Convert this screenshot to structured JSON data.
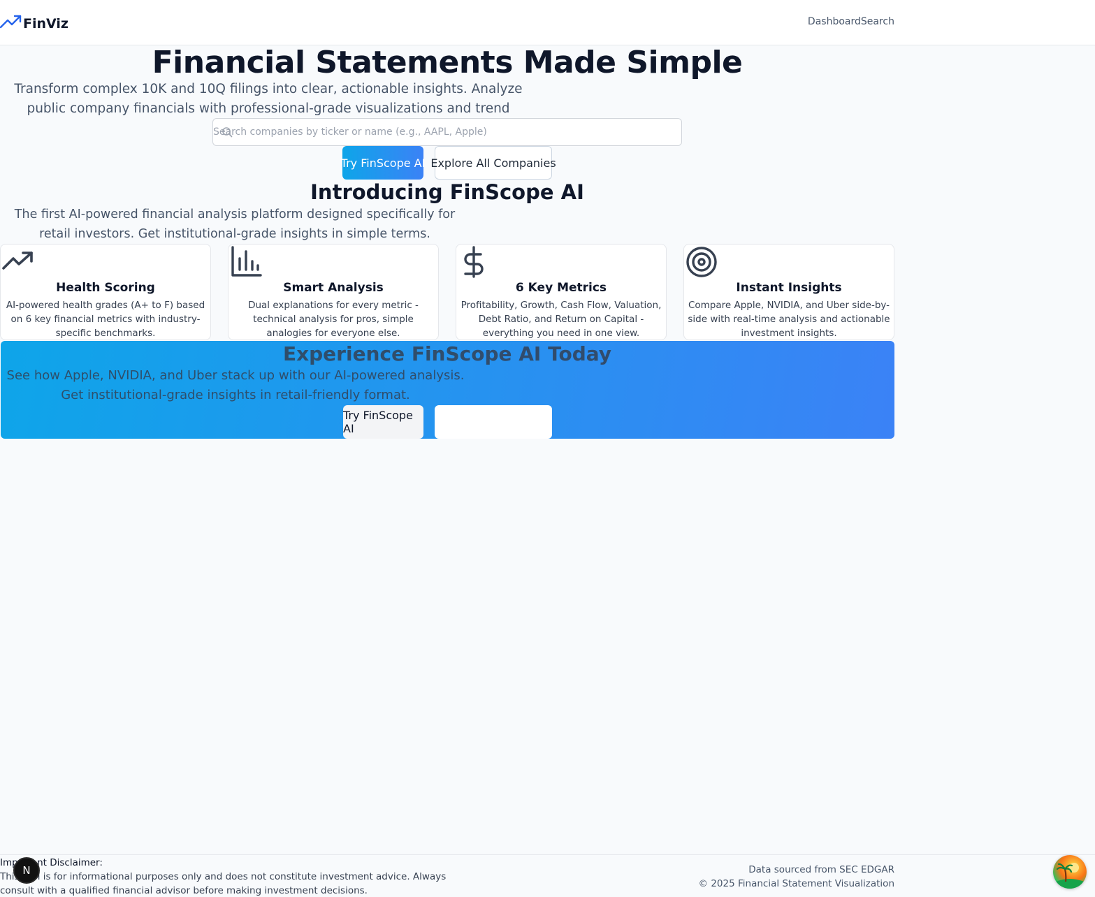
{
  "header": {
    "brand": "FinViz",
    "nav": [
      "Dashboard",
      "Search"
    ]
  },
  "hero": {
    "title": "Financial Statements Made Simple",
    "subtitle": "Transform complex 10K and 10Q filings into clear, actionable insights. Analyze public company financials with professional-grade visualizations and trend analysis.",
    "search_placeholder": "Search companies by ticker or name (e.g., AAPL, Apple)",
    "search_value": "",
    "primary_button": "Try FinScope AI",
    "secondary_button": "Explore All Companies"
  },
  "intro": {
    "title": "Introducing FinScope AI",
    "subtitle": "The first AI-powered financial analysis platform designed specifically for retail investors. Get institutional-grade insights in simple terms."
  },
  "features": [
    {
      "icon": "trending-up-icon",
      "title": "Health Scoring",
      "description": "AI-powered health grades (A+ to F) based on 6 key financial metrics with industry-specific benchmarks."
    },
    {
      "icon": "bar-chart-icon",
      "title": "Smart Analysis",
      "description": "Dual explanations for every metric - technical analysis for pros, simple analogies for everyone else."
    },
    {
      "icon": "dollar-sign-icon",
      "title": "6 Key Metrics",
      "description": "Profitability, Growth, Cash Flow, Valuation, Debt Ratio, and Return on Capital - everything you need in one view."
    },
    {
      "icon": "target-icon",
      "title": "Instant Insights",
      "description": "Compare Apple, NVIDIA, and Uber side-by-side with real-time analysis and actionable investment insights."
    }
  ],
  "cta": {
    "title": "Experience FinScope AI Today",
    "subtitle": "See how Apple, NVIDIA, and Uber stack up with our AI-powered analysis. Get institutional-grade insights in retail-friendly format.",
    "primary_button": "Try FinScope AI",
    "secondary_button": ""
  },
  "footer": {
    "disclaimer_title": "Important Disclaimer:",
    "disclaimer_text": "This tool is for informational purposes only and does not constitute investment advice. Always consult with a qualified financial advisor before making investment decisions.",
    "source": "Data sourced from SEC EDGAR",
    "copyright": "© 2025 Financial Statement Visualization"
  },
  "overlay": {
    "next_badge": "N"
  },
  "colors": {
    "accent": "#3b82f6",
    "accent_start": "#0ea5e9",
    "text": "#0f172a",
    "muted": "#475569",
    "background": "#f8fafc"
  }
}
